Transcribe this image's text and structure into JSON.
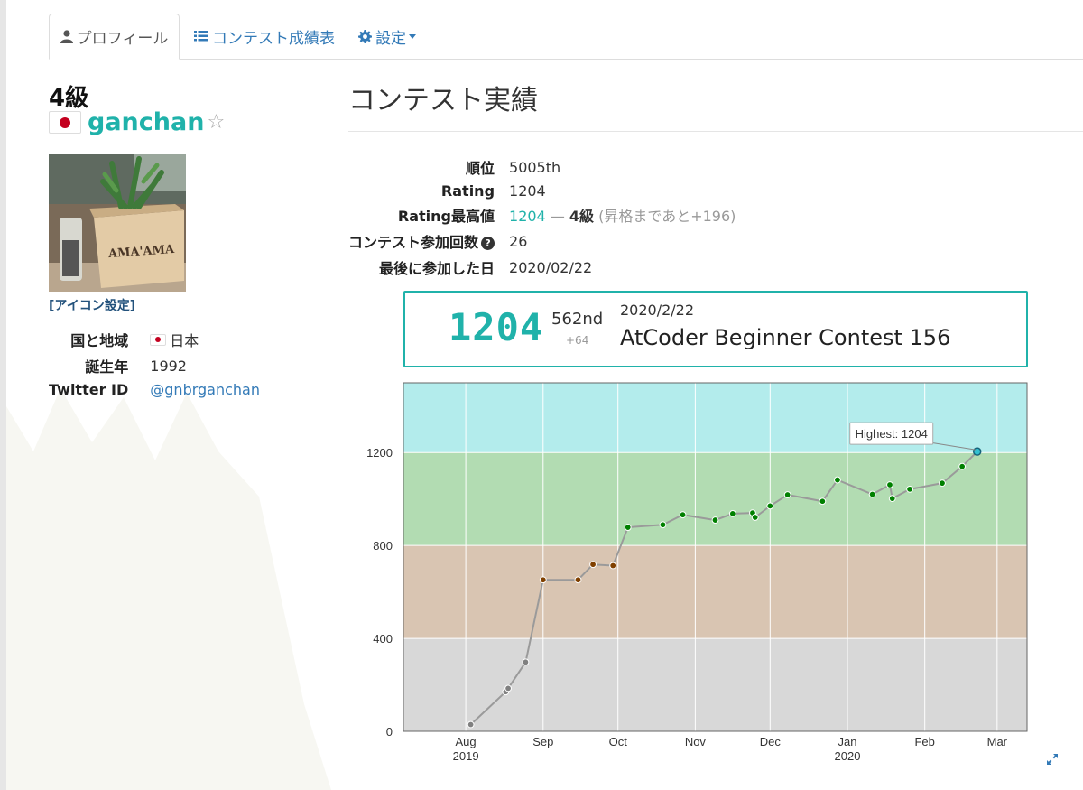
{
  "tabs": {
    "profile": "プロフィール",
    "history": "コンテスト成績表",
    "settings": "設定"
  },
  "profile": {
    "rank": "4級",
    "username": "ganchan",
    "favorite_icon": "star-outline-icon",
    "avatar_engraving": "AMA'AMA",
    "icon_setting_link": "[アイコン設定]",
    "rows": [
      {
        "label": "国と地域",
        "value": "日本",
        "flag": "JP"
      },
      {
        "label": "誕生年",
        "value": "1992"
      },
      {
        "label": "Twitter ID",
        "value": "@gnbrganchan"
      }
    ]
  },
  "contest": {
    "section_title": "コンテスト実績",
    "stats": {
      "rank_label": "順位",
      "rank_value": "5005th",
      "rating_label": "Rating",
      "rating_value": "1204",
      "max_label": "Rating最高値",
      "max_value": "1204",
      "max_sep": " — ",
      "max_class": "4級",
      "max_note": "(昇格まであと+196)",
      "count_label": "コンテスト参加回数",
      "count_value": "26",
      "last_label": "最後に参加した日",
      "last_value": "2020/02/22"
    },
    "latest": {
      "rating": "1204",
      "rank": "562nd",
      "diff": "+64",
      "date": "2020/2/22",
      "name": "AtCoder Beginner Contest 156"
    }
  },
  "colors": {
    "accent_teal": "#20b2aa",
    "link": "#337ab7",
    "band_grey": "#d8d8d8",
    "band_brown": "#d9c5b2",
    "band_green": "#b2dcb2",
    "band_cyan": "#b3ecec"
  },
  "chart_data": {
    "type": "line",
    "series": [
      {
        "name": "Rating",
        "points": [
          [
            "2019-08-03",
            29
          ],
          [
            "2019-08-17",
            170
          ],
          [
            "2019-08-18",
            185
          ],
          [
            "2019-08-25",
            298
          ],
          [
            "2019-09-01",
            652
          ],
          [
            "2019-09-15",
            652
          ],
          [
            "2019-09-21",
            718
          ],
          [
            "2019-09-29",
            713
          ],
          [
            "2019-10-05",
            878
          ],
          [
            "2019-10-19",
            889
          ],
          [
            "2019-10-27",
            932
          ],
          [
            "2019-11-09",
            909
          ],
          [
            "2019-11-16",
            937
          ],
          [
            "2019-11-24",
            940
          ],
          [
            "2019-11-25",
            921
          ],
          [
            "2019-12-01",
            970
          ],
          [
            "2019-12-08",
            1018
          ],
          [
            "2019-12-22",
            990
          ],
          [
            "2019-12-28",
            1082
          ],
          [
            "2020-01-11",
            1020
          ],
          [
            "2020-01-18",
            1061
          ],
          [
            "2020-01-19",
            1002
          ],
          [
            "2020-01-26",
            1042
          ],
          [
            "2020-02-08",
            1068
          ],
          [
            "2020-02-16",
            1140
          ],
          [
            "2020-02-22",
            1204
          ]
        ]
      }
    ],
    "ylim": [
      0,
      1500
    ],
    "yticks": [
      "0",
      "400",
      "800",
      "1200"
    ],
    "xticks": [
      {
        "date": "2019-08-01",
        "label": "Aug",
        "sub": "2019"
      },
      {
        "date": "2019-09-01",
        "label": "Sep",
        "sub": ""
      },
      {
        "date": "2019-10-01",
        "label": "Oct",
        "sub": ""
      },
      {
        "date": "2019-11-01",
        "label": "Nov",
        "sub": ""
      },
      {
        "date": "2019-12-01",
        "label": "Dec",
        "sub": ""
      },
      {
        "date": "2020-01-01",
        "label": "Jan",
        "sub": "2020"
      },
      {
        "date": "2020-02-01",
        "label": "Feb",
        "sub": ""
      },
      {
        "date": "2020-03-01",
        "label": "Mar",
        "sub": ""
      }
    ],
    "bands": [
      {
        "from": 0,
        "to": 400,
        "color": "#d8d8d8"
      },
      {
        "from": 400,
        "to": 800,
        "color": "#d9c5b2"
      },
      {
        "from": 800,
        "to": 1200,
        "color": "#b2dcb2"
      },
      {
        "from": 1200,
        "to": 1500,
        "color": "#b3ecec"
      }
    ],
    "annotation": "Highest: 1204",
    "grid": true
  }
}
